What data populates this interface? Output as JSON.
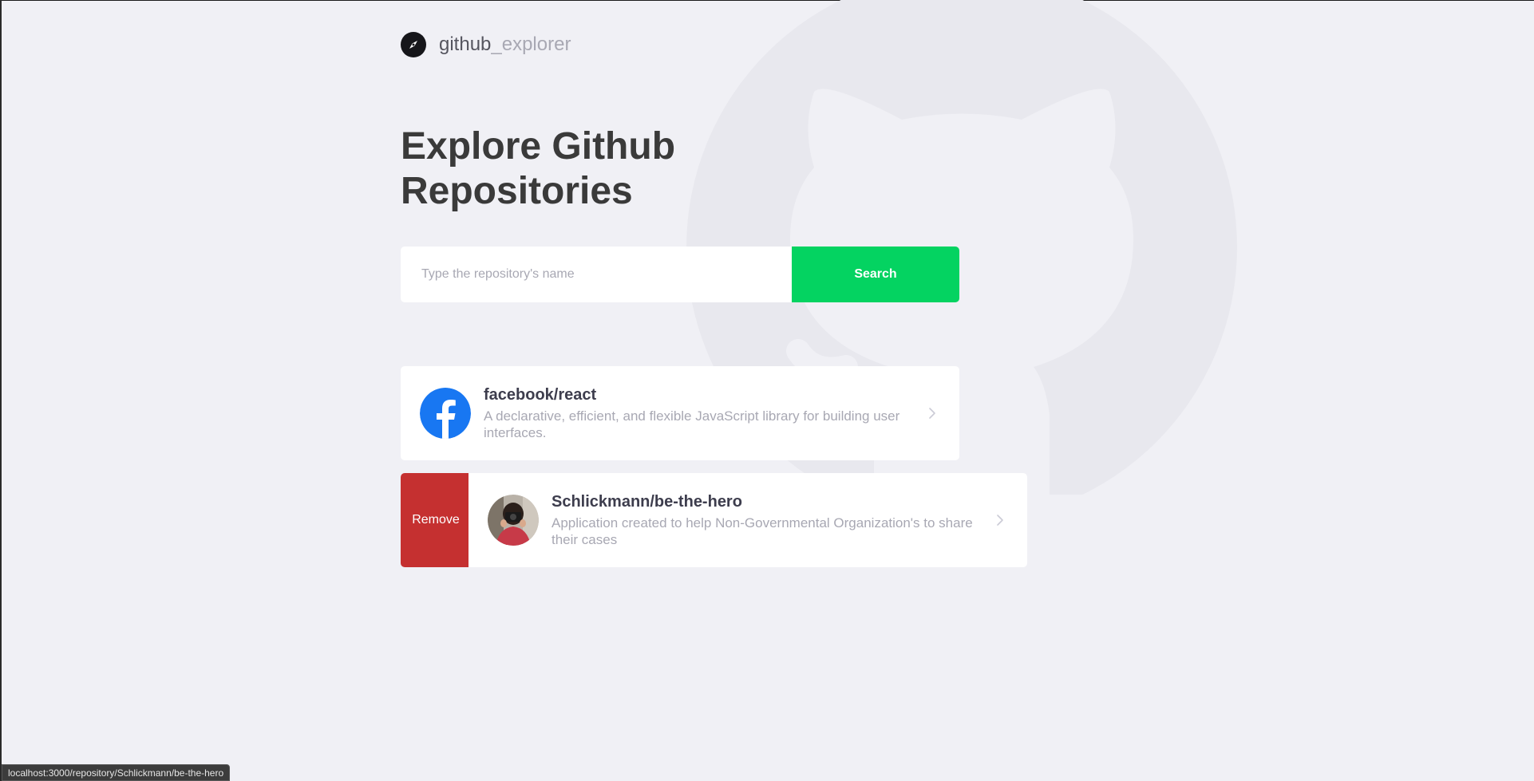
{
  "app": {
    "logo_main": "github",
    "logo_sub": "_explorer"
  },
  "hero": {
    "title": "Explore Github Repositories"
  },
  "search": {
    "placeholder": "Type the repository's name",
    "value": "",
    "button_label": "Search"
  },
  "repositories": [
    {
      "name": "facebook/react",
      "description": "A declarative, efficient, and flexible JavaScript library for building user interfaces.",
      "avatar": "facebook-logo"
    },
    {
      "name": "Schlickmann/be-the-hero",
      "description": "Application created to help Non-Governmental Organization's to share their cases",
      "avatar": "user-photo",
      "remove_label": "Remove"
    }
  ],
  "status_bar": {
    "url": "localhost:3000/repository/Schlickmann/be-the-hero"
  },
  "colors": {
    "accent_green": "#04d361",
    "remove_red": "#c53030",
    "background": "#f0f0f5"
  }
}
